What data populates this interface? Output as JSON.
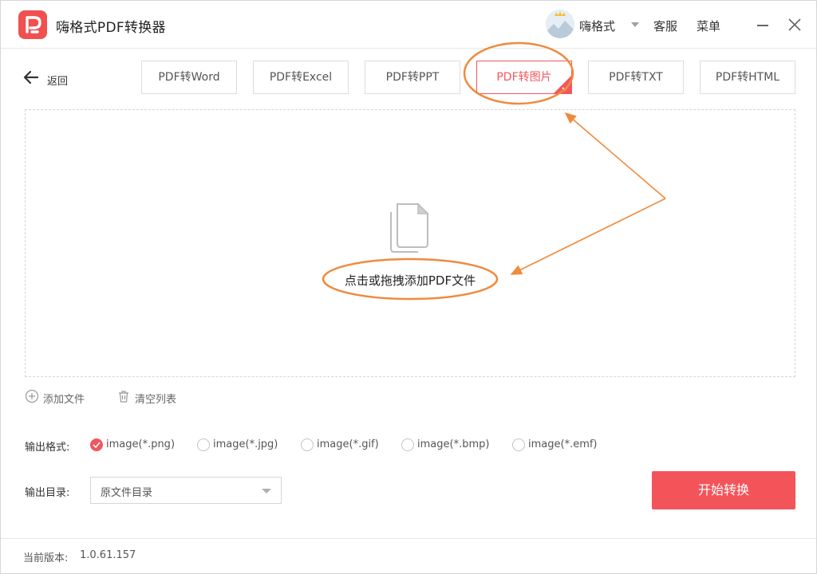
{
  "app": {
    "title": "嗨格式PDF转换器",
    "user_name": "嗨格式",
    "service_label": "客服",
    "menu_label": "菜单"
  },
  "toolbar": {
    "back_label": "返回",
    "tabs": [
      {
        "label": "PDF转Word",
        "active": false
      },
      {
        "label": "PDF转Excel",
        "active": false
      },
      {
        "label": "PDF转PPT",
        "active": false
      },
      {
        "label": "PDF转图片",
        "active": true
      },
      {
        "label": "PDF转TXT",
        "active": false
      },
      {
        "label": "PDF转HTML",
        "active": false
      }
    ]
  },
  "dropzone": {
    "text": "点击或拖拽添加PDF文件",
    "icon": "document-stack-icon"
  },
  "list_actions": {
    "add_file": "添加文件",
    "clear_list": "清空列表"
  },
  "output_format": {
    "label": "输出格式:",
    "options": [
      {
        "label": "image(*.png)",
        "checked": true
      },
      {
        "label": "image(*.jpg)",
        "checked": false
      },
      {
        "label": "image(*.gif)",
        "checked": false
      },
      {
        "label": "image(*.bmp)",
        "checked": false
      },
      {
        "label": "image(*.emf)",
        "checked": false
      }
    ]
  },
  "output_dir": {
    "label": "输出目录:",
    "value": "原文件目录"
  },
  "start_button": "开始转换",
  "footer": {
    "version_label": "当前版本:",
    "version": "1.0.61.157"
  },
  "colors": {
    "accent": "#f3545a",
    "annotation": "#f08a3c"
  }
}
